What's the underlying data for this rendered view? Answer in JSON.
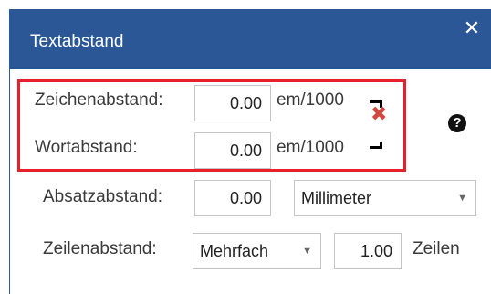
{
  "dialog": {
    "title": "Textabstand",
    "close_glyph": "✕"
  },
  "character_spacing": {
    "label": "Zeichenabstand:",
    "value": "0.00",
    "unit": "em/1000"
  },
  "word_spacing": {
    "label": "Wortabstand:",
    "value": "0.00",
    "unit": "em/1000"
  },
  "paragraph_spacing": {
    "label": "Absatzabstand:",
    "value": "0.00",
    "unit_select": "Millimeter"
  },
  "line_spacing": {
    "label": "Zeilenabstand:",
    "mode_select": "Mehrfach",
    "value": "1.00",
    "unit": "Zeilen"
  },
  "icons": {
    "reset": "x-icon",
    "help": "help-icon",
    "caret": "▼",
    "help_glyph": "?"
  },
  "colors": {
    "titlebar": "#2b5797",
    "highlight": "#e8202c",
    "reset_x": "#d14840"
  }
}
